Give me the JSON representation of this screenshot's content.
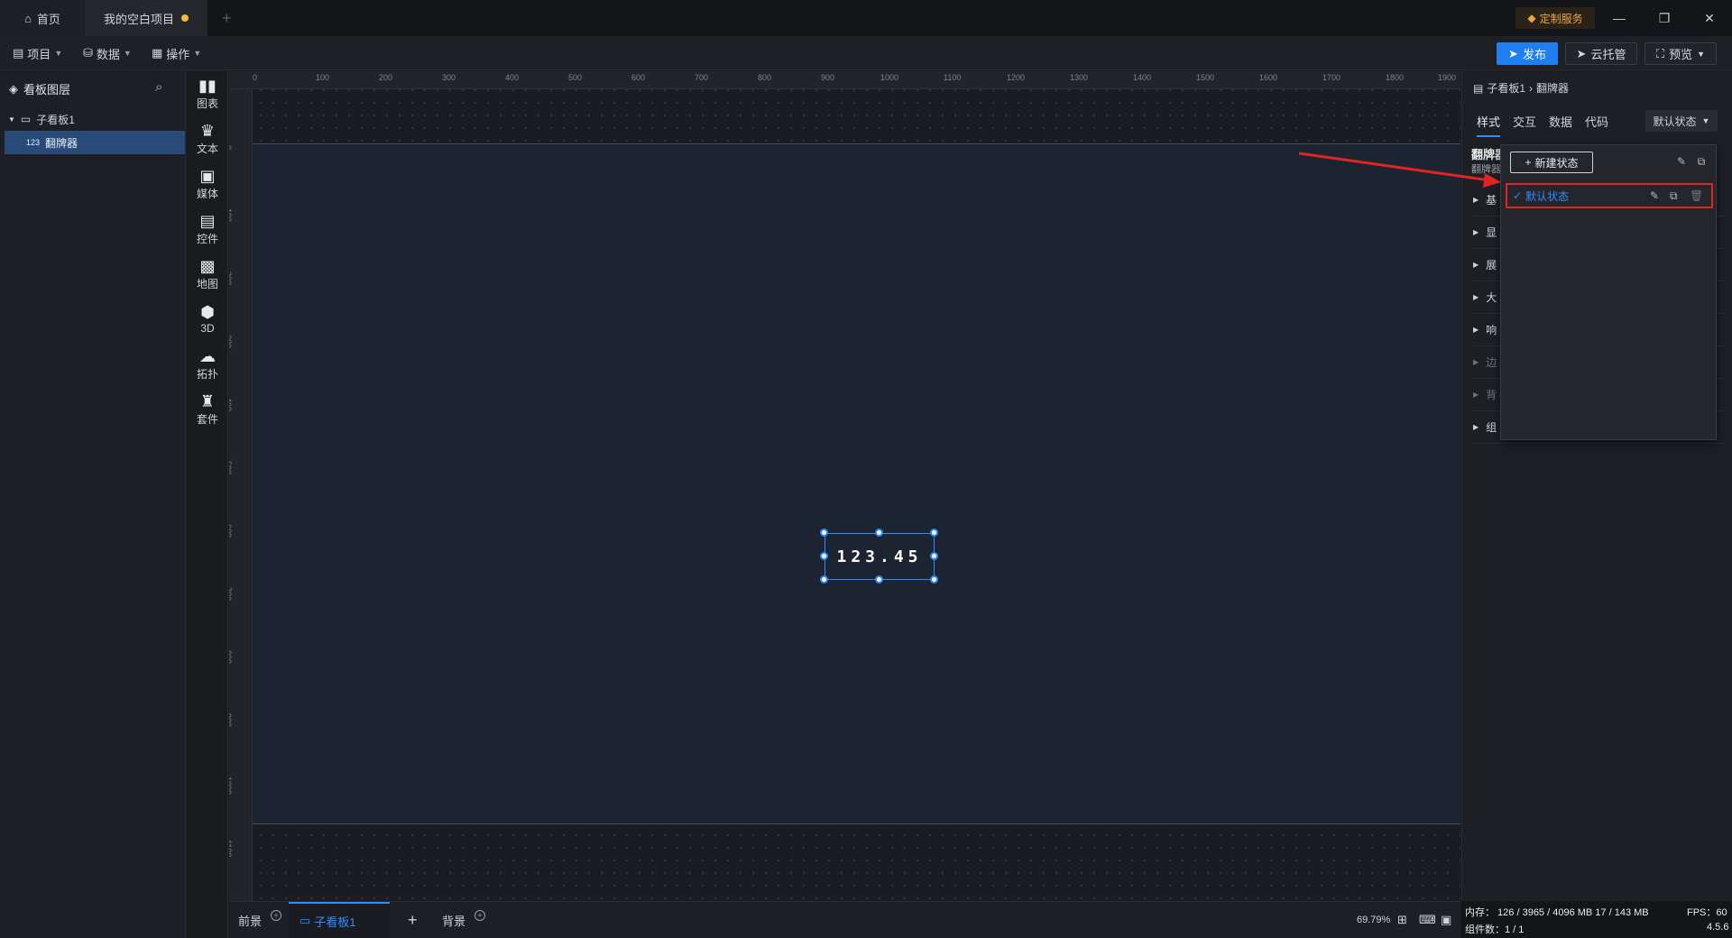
{
  "titlebar": {
    "tabs": [
      {
        "label": "首页",
        "icon": "home-icon"
      },
      {
        "label": "我的空白项目",
        "icon": "unsaved-dot"
      }
    ],
    "service_label": "定制服务",
    "window_controls": [
      "minimize-icon",
      "restore-icon",
      "close-icon"
    ]
  },
  "toolbar": {
    "menus": [
      {
        "label": "项目",
        "icon": "file-icon"
      },
      {
        "label": "数据",
        "icon": "database-icon"
      },
      {
        "label": "操作",
        "icon": "grid-icon"
      }
    ],
    "publish_label": "发布",
    "cloud_label": "云托管",
    "preview_label": "预览"
  },
  "layers": {
    "title": "看板图层",
    "tree": [
      {
        "label": "子看板1",
        "level": 0,
        "expanded": true
      },
      {
        "label": "翻牌器",
        "level": 1,
        "selected": true
      }
    ]
  },
  "rail": {
    "items": [
      {
        "label": "图表",
        "icon": "chart-icon"
      },
      {
        "label": "文本",
        "icon": "text-icon"
      },
      {
        "label": "媒体",
        "icon": "media-icon"
      },
      {
        "label": "控件",
        "icon": "control-icon"
      },
      {
        "label": "地图",
        "icon": "map-icon"
      },
      {
        "label": "3D",
        "icon": "cube-icon"
      },
      {
        "label": "拓扑",
        "icon": "topology-icon"
      },
      {
        "label": "套件",
        "icon": "kit-icon"
      }
    ]
  },
  "canvas": {
    "ruler_top": [
      "0",
      "100",
      "200",
      "300",
      "400",
      "500",
      "600",
      "700",
      "800",
      "900",
      "1000",
      "1100",
      "1200",
      "1300",
      "1400",
      "1500",
      "1600",
      "1700",
      "1800",
      "1900"
    ],
    "ruler_left": [
      "0",
      "100",
      "200",
      "300",
      "400",
      "500",
      "600",
      "700",
      "800",
      "900",
      "1000",
      "1100"
    ],
    "flipper_value": "123.45"
  },
  "bottom": {
    "tabs": [
      {
        "label": "前景"
      },
      {
        "label": "子看板1",
        "active": true
      },
      {
        "label": "背景"
      }
    ],
    "zoom": "69.79%"
  },
  "right": {
    "breadcrumb": [
      "子看板1",
      "翻牌器"
    ],
    "tabs": [
      "样式",
      "交互",
      "数据",
      "代码"
    ],
    "state_select": "默认状态",
    "component_name": "翻牌器",
    "component_sub": "翻牌器",
    "sections": [
      "基",
      "显",
      "展",
      "大",
      "响",
      "边",
      "背",
      "组"
    ],
    "popup": {
      "new_state_label": "新建状态",
      "states": [
        {
          "label": "默认状态",
          "checked": true
        }
      ]
    }
  },
  "status": {
    "memory": "内存： 126 / 3965 / 4096 MB  17 / 143 MB",
    "fps": "FPS：60",
    "components": "组件数：1 / 1",
    "version": "4.5.6"
  }
}
